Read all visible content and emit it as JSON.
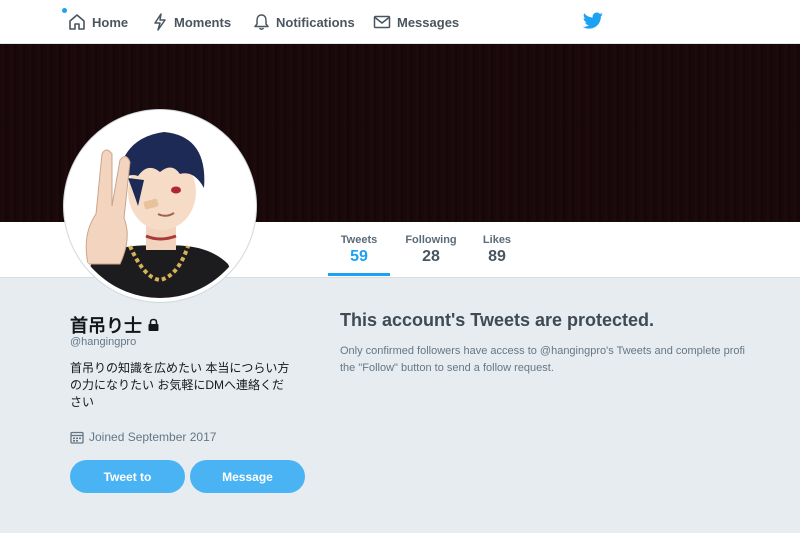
{
  "nav": {
    "home": "Home",
    "moments": "Moments",
    "notifications": "Notifications",
    "messages": "Messages"
  },
  "colors": {
    "accent": "#1da1f2",
    "button": "#4ab3f4",
    "background": "#e6ecf0"
  },
  "stats": {
    "tweets_label": "Tweets",
    "tweets_value": "59",
    "following_label": "Following",
    "following_value": "28",
    "likes_label": "Likes",
    "likes_value": "89"
  },
  "profile": {
    "name": "首吊り士",
    "handle": "@hangingpro",
    "bio_line1": "首吊りの知識を広めたい 本当につらい方",
    "bio_line2": "の力になりたい お気軽にDMへ連絡くだ",
    "bio_line3": "さい",
    "joined": "Joined September 2017",
    "tweet_to_button": "Tweet to",
    "message_button": "Message"
  },
  "protected": {
    "title": "This account's Tweets are protected.",
    "line1": "Only confirmed followers have access to @hangingpro's Tweets and complete profi",
    "line2": "the \"Follow\" button to send a follow request."
  }
}
